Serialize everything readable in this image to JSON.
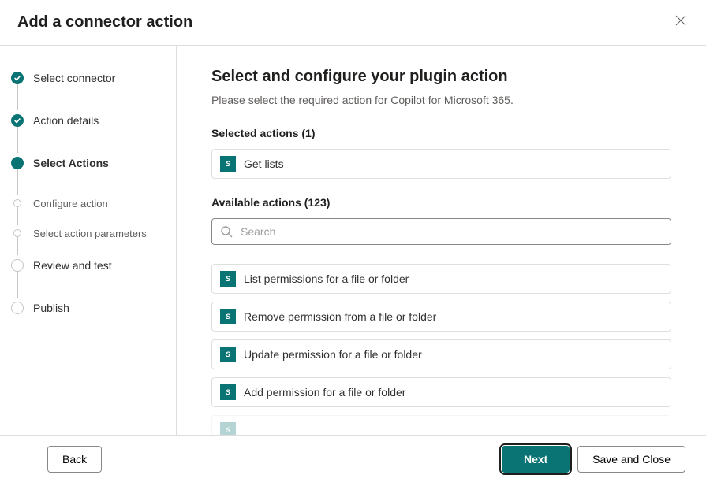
{
  "header": {
    "title": "Add a connector action"
  },
  "steps": [
    {
      "label": "Select connector",
      "state": "done",
      "size": "big"
    },
    {
      "label": "Action details",
      "state": "done",
      "size": "big"
    },
    {
      "label": "Select Actions",
      "state": "current",
      "size": "big"
    },
    {
      "label": "Configure action",
      "state": "future",
      "size": "small"
    },
    {
      "label": "Select action parameters",
      "state": "future",
      "size": "small"
    },
    {
      "label": "Review and test",
      "state": "future",
      "size": "big"
    },
    {
      "label": "Publish",
      "state": "future",
      "size": "big"
    }
  ],
  "main": {
    "heading": "Select and configure your plugin action",
    "subheading": "Please select the required action for Copilot for Microsoft 365.",
    "selected_label": "Selected actions (1)",
    "selected_actions": [
      {
        "name": "Get lists"
      }
    ],
    "available_label": "Available actions (123)",
    "search_placeholder": "Search",
    "available_actions": [
      {
        "name": "List permissions for a file or folder"
      },
      {
        "name": "Remove permission from a file or folder"
      },
      {
        "name": "Update permission for a file or folder"
      },
      {
        "name": "Add permission for a file or folder"
      },
      {
        "name": ""
      }
    ]
  },
  "footer": {
    "back": "Back",
    "next": "Next",
    "save": "Save and Close"
  },
  "icon_label": "S"
}
